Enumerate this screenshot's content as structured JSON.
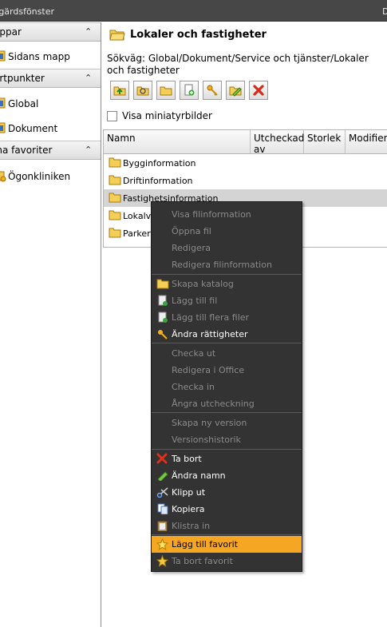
{
  "titlebar": {
    "title": "tgärdsfönster",
    "right_char": "D"
  },
  "sidebar": {
    "sections": [
      {
        "label": "appar",
        "items": [
          {
            "label": "Sidans mapp",
            "icon": "folder-page-icon"
          }
        ]
      },
      {
        "label": "artpunkter",
        "items": [
          {
            "label": "Global",
            "icon": "folder-global-icon"
          },
          {
            "label": "Dokument",
            "icon": "folder-document-icon"
          }
        ]
      },
      {
        "label": "ina favoriter",
        "items": [
          {
            "label": "Ögonkliniken",
            "icon": "favorite-folder-icon"
          }
        ]
      }
    ]
  },
  "main": {
    "title": "Lokaler och fastigheter",
    "path": "Sökväg: Global/Dokument/Service och tjänster/Lokaler och fastigheter",
    "show_thumbnails_label": "Visa miniatyrbilder",
    "toolbar": [
      "folder-up-icon",
      "folder-search-icon",
      "new-folder-icon",
      "add-file-icon",
      "permissions-key-icon",
      "rename-icon",
      "delete-icon"
    ]
  },
  "grid": {
    "columns": [
      "Namn",
      "Utcheckad av",
      "Storlek",
      "Modifier"
    ],
    "rows": [
      "Bygginformation",
      "Driftinformation",
      "Fastighetsinformation",
      "Lokalvård",
      "Parkering"
    ]
  },
  "context_menu": {
    "groups": [
      [
        {
          "label": "Visa filinformation",
          "enabled": false
        },
        {
          "label": "Öppna fil",
          "enabled": false
        },
        {
          "label": "Redigera",
          "enabled": false
        },
        {
          "label": "Redigera filinformation",
          "enabled": false
        }
      ],
      [
        {
          "label": "Skapa katalog",
          "enabled": false,
          "icon": "folder-icon"
        },
        {
          "label": "Lägg till fil",
          "enabled": false,
          "icon": "add-file-icon"
        },
        {
          "label": "Lägg till flera filer",
          "enabled": false,
          "icon": "add-files-icon"
        },
        {
          "label": "Ändra rättigheter",
          "enabled": true,
          "icon": "key-icon"
        }
      ],
      [
        {
          "label": "Checka ut",
          "enabled": false
        },
        {
          "label": "Redigera i Office",
          "enabled": false
        },
        {
          "label": "Checka in",
          "enabled": false
        },
        {
          "label": "Ångra utcheckning",
          "enabled": false
        }
      ],
      [
        {
          "label": "Skapa ny version",
          "enabled": false
        },
        {
          "label": "Versionshistorik",
          "enabled": false
        }
      ],
      [
        {
          "label": "Ta bort",
          "enabled": true,
          "icon": "delete-icon"
        },
        {
          "label": "Ändra namn",
          "enabled": true,
          "icon": "rename-icon"
        },
        {
          "label": "Klipp ut",
          "enabled": true,
          "icon": "cut-icon"
        },
        {
          "label": "Kopiera",
          "enabled": true,
          "icon": "copy-icon"
        },
        {
          "label": "Klistra in",
          "enabled": false,
          "icon": "paste-icon"
        }
      ],
      [
        {
          "label": "Lägg till favorit",
          "enabled": true,
          "highlighted": true,
          "icon": "star-icon"
        },
        {
          "label": "Ta bort favorit",
          "enabled": false,
          "icon": "star-icon"
        }
      ]
    ]
  },
  "colors": {
    "titlebar": "#474747",
    "menu_bg": "#333333",
    "menu_highlight": "#f5a623",
    "selected_row": "#d4d4d4"
  }
}
